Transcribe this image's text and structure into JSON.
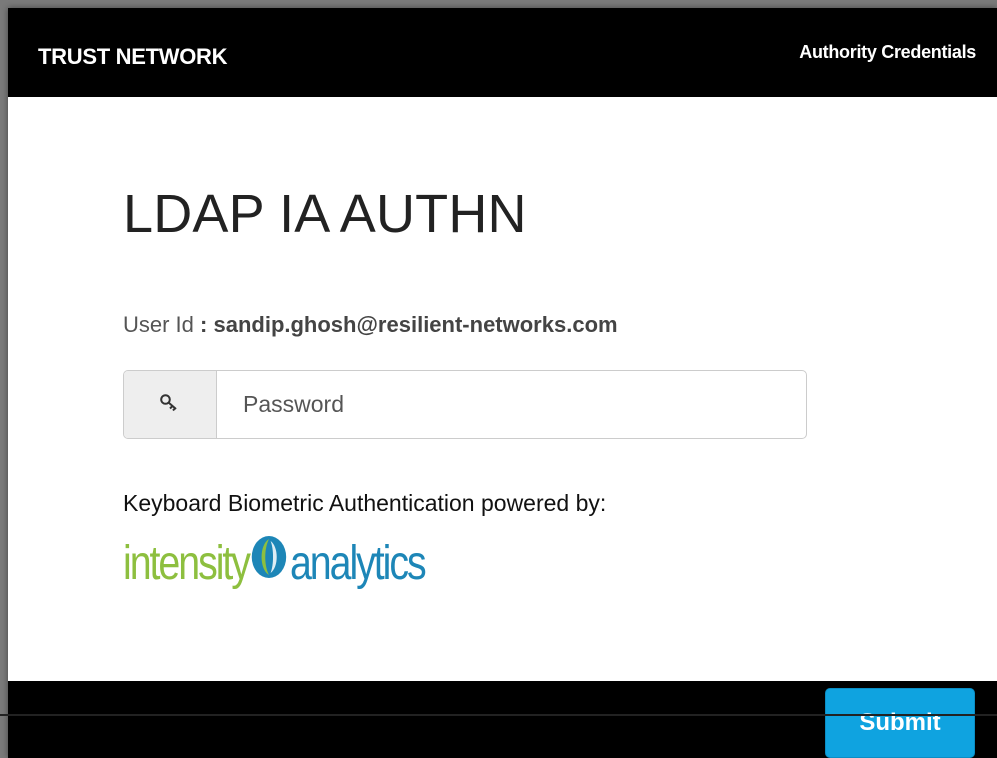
{
  "header": {
    "brand": "TRUST NETWORK",
    "authority_link": "Authority Credentials"
  },
  "main": {
    "title": "LDAP IA AUTHN",
    "user_id_label": "User Id",
    "user_id_separator": " : ",
    "user_id_value": "sandip.ghosh@resilient-networks.com",
    "password": {
      "placeholder": "Password",
      "value": "",
      "icon": "key-icon"
    },
    "biometric_text": "Keyboard Biometric Authentication powered by:",
    "logo": {
      "word1": "intensity",
      "word2": "analytics",
      "icon": "intensity-analytics-logo-icon"
    }
  },
  "footer": {
    "submit_label": "Submit"
  },
  "colors": {
    "bar_background": "#000000",
    "submit_button": "#0fa3e0",
    "logo_green": "#8dbf3f",
    "logo_blue": "#1d86b7"
  }
}
